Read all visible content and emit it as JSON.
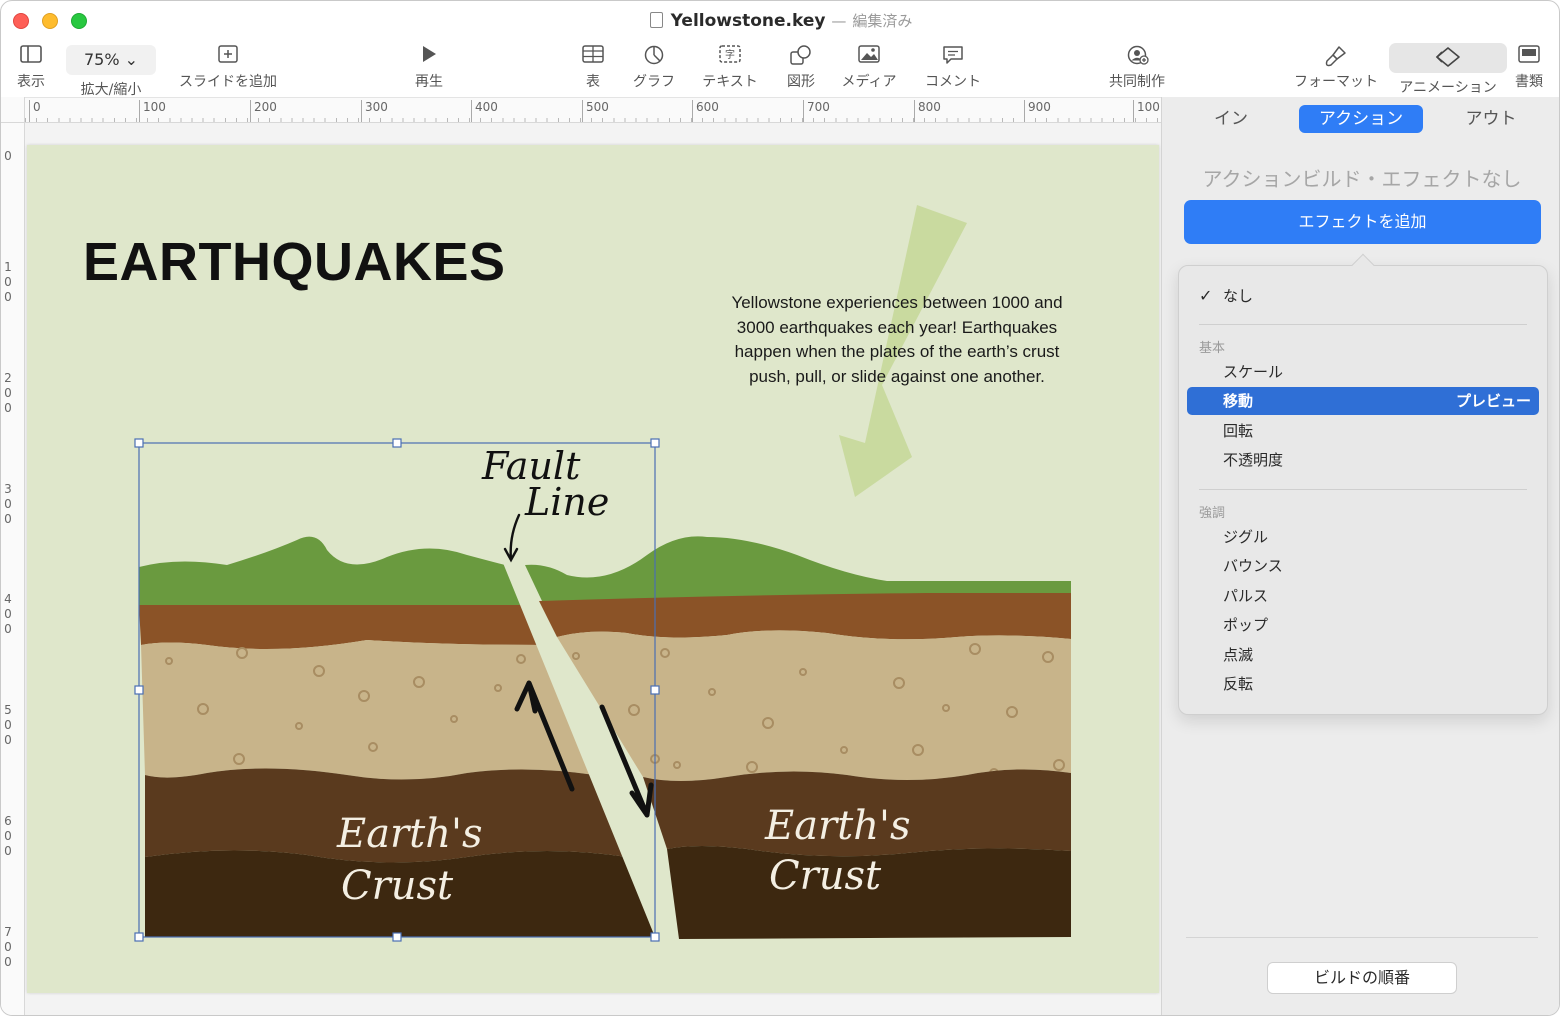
{
  "window": {
    "title": "Yellowstone.key",
    "separator": "—",
    "edited": "編集済み"
  },
  "toolbar": {
    "view": "表示",
    "zoom_value": "75% ⌄",
    "zoom": "拡大/縮小",
    "add_slide": "スライドを追加",
    "play": "再生",
    "table": "表",
    "chart": "グラフ",
    "text": "テキスト",
    "shape": "図形",
    "media": "メディア",
    "comment": "コメント",
    "collaborate": "共同制作",
    "format": "フォーマット",
    "animate": "アニメーション",
    "document": "書類"
  },
  "ruler": {
    "top": [
      "0",
      "100",
      "200",
      "300",
      "400",
      "500",
      "600",
      "700",
      "800",
      "900",
      "100"
    ],
    "left": [
      "0",
      "1 0 0",
      "2 0 0",
      "3 0 0",
      "4 0 0",
      "5 0 0",
      "6 0 0",
      "7 0 0"
    ]
  },
  "slide": {
    "title": "EARTHQUAKES",
    "body_lines": [
      "Yellowstone experiences between 1000 and",
      "3000 earthquakes each year! Earthquakes",
      "happen when the plates of the earth’s crust",
      "push, pull, or slide against one another."
    ],
    "fault_label": [
      "Fault",
      "Line"
    ],
    "crust_left": [
      "Earth's",
      "Crust"
    ],
    "crust_right": [
      "Earth's",
      "Crust"
    ]
  },
  "inspector": {
    "tabs": [
      "イン",
      "アクション",
      "アウト"
    ],
    "active_tab": "アクション",
    "no_effect": "アクションビルド・エフェクトなし",
    "add_effect": "エフェクトを追加",
    "menu": {
      "none": "なし",
      "basic_header": "基本",
      "basic": [
        "スケール",
        "移動",
        "回転",
        "不透明度"
      ],
      "selected": "移動",
      "preview": "プレビュー",
      "emphasis_header": "強調",
      "emphasis": [
        "ジグル",
        "バウンス",
        "パルス",
        "ポップ",
        "点滅",
        "反転"
      ]
    },
    "build_order": "ビルドの順番"
  },
  "colors": {
    "accent": "#2f7df6",
    "slide_bg": "#dfe7cb",
    "grass": "#6a9a3f",
    "topsoil": "#8b5327",
    "sand": "#c8b48a",
    "crust": "#5a3a1e",
    "deep_crust": "#3d2810"
  }
}
